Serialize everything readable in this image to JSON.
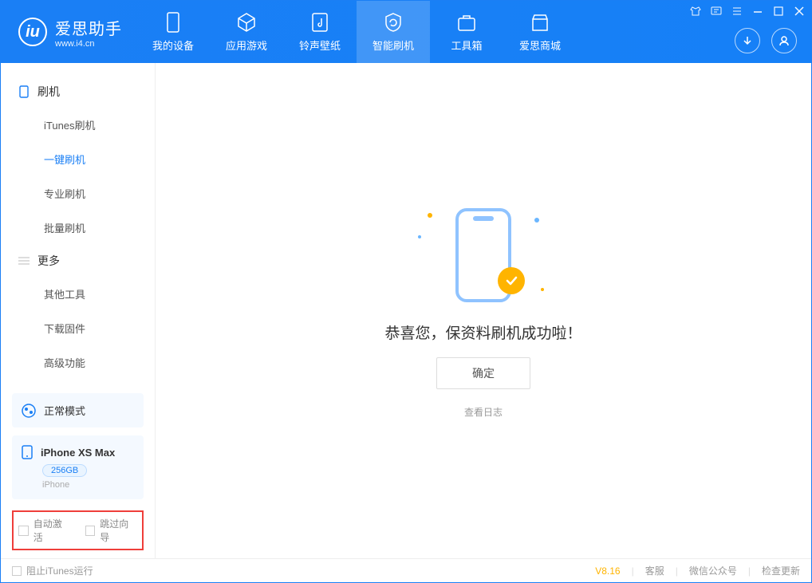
{
  "header": {
    "app_name": "爱思助手",
    "app_url": "www.i4.cn",
    "tabs": [
      {
        "label": "我的设备"
      },
      {
        "label": "应用游戏"
      },
      {
        "label": "铃声壁纸"
      },
      {
        "label": "智能刷机"
      },
      {
        "label": "工具箱"
      },
      {
        "label": "爱思商城"
      }
    ]
  },
  "sidebar": {
    "section1_title": "刷机",
    "section1_items": [
      {
        "label": "iTunes刷机"
      },
      {
        "label": "一键刷机"
      },
      {
        "label": "专业刷机"
      },
      {
        "label": "批量刷机"
      }
    ],
    "section2_title": "更多",
    "section2_items": [
      {
        "label": "其他工具"
      },
      {
        "label": "下载固件"
      },
      {
        "label": "高级功能"
      }
    ],
    "mode_label": "正常模式",
    "device": {
      "name": "iPhone XS Max",
      "capacity": "256GB",
      "type": "iPhone"
    },
    "checkbox1": "自动激活",
    "checkbox2": "跳过向导"
  },
  "main": {
    "success_text": "恭喜您，保资料刷机成功啦！",
    "ok_button": "确定",
    "view_log": "查看日志"
  },
  "statusbar": {
    "block_itunes": "阻止iTunes运行",
    "version": "V8.16",
    "link1": "客服",
    "link2": "微信公众号",
    "link3": "检查更新"
  }
}
